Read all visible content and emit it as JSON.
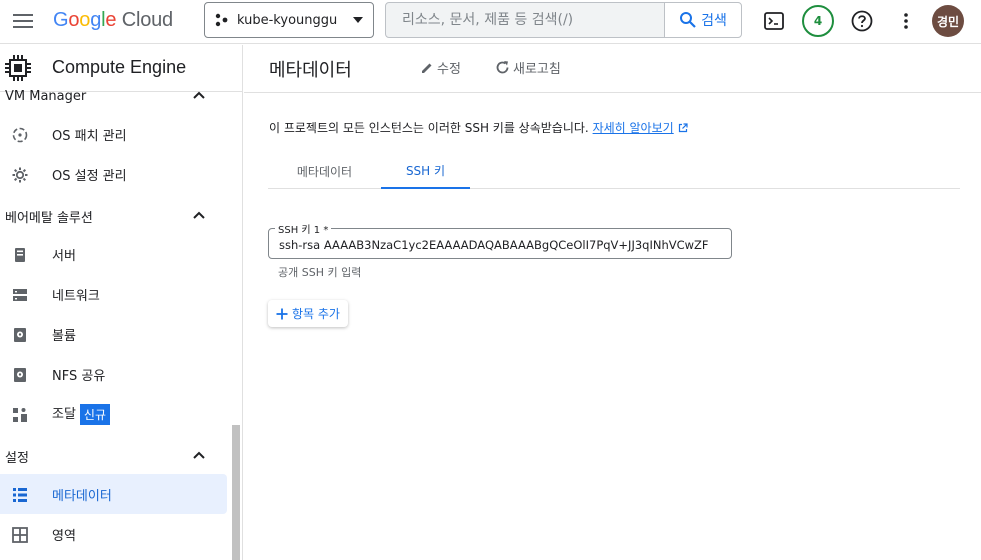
{
  "topbar": {
    "logo": {
      "g1": "G",
      "g2": "o",
      "g3": "o",
      "g4": "g",
      "g5": "l",
      "g6": "e",
      "cloud": "Cloud"
    },
    "project": "kube-kyounggu",
    "search_placeholder": "리소스, 문서, 제품 등 검색(/)",
    "search_button": "검색",
    "notification_count": "4",
    "avatar": "경민"
  },
  "sidebar": {
    "product_title": "Compute Engine",
    "sections": [
      {
        "label": "VM Manager",
        "items": [
          {
            "label": "OS 패치 관리"
          },
          {
            "label": "OS 설정 관리"
          }
        ]
      },
      {
        "label": "베어메탈 솔루션",
        "items": [
          {
            "label": "서버"
          },
          {
            "label": "네트워크"
          },
          {
            "label": "볼륨"
          },
          {
            "label": "NFS 공유"
          },
          {
            "label": "조달",
            "tag": "신규"
          }
        ]
      },
      {
        "label": "설정",
        "items": [
          {
            "label": "메타데이터"
          },
          {
            "label": "영역"
          }
        ]
      }
    ]
  },
  "main": {
    "title": "메타데이터",
    "edit_label": "수정",
    "refresh_label": "새로고침",
    "description": "이 프로젝트의 모든 인스턴스는 이러한 SSH 키를 상속받습니다.",
    "learn_more": "자세히 알아보기",
    "tabs": [
      {
        "label": "메타데이터"
      },
      {
        "label": "SSH 키"
      }
    ],
    "ssh_field_label": "SSH 키 1 *",
    "ssh_field_value": "ssh-rsa AAAAB3NzaC1yc2EAAAADAQABAAABgQCeOlI7PqV+JJ3qINhVCwZF",
    "ssh_field_hint": "공개 SSH 키 입력",
    "add_item": "항목 추가"
  },
  "colors": {
    "accent": "#1a73e8",
    "active_bg": "#e8f0fe",
    "badge_green": "#1e8e3e",
    "avatar_bg": "#6d4c41"
  }
}
